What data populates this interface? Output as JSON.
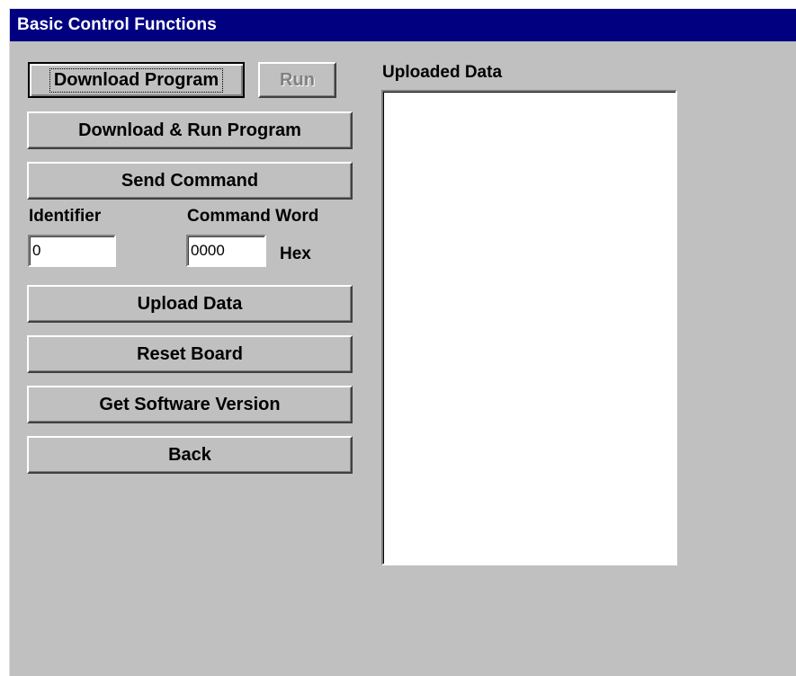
{
  "window": {
    "title": "Basic Control Functions"
  },
  "buttons": {
    "download_program": "Download Program",
    "run": "Run",
    "download_run_program": "Download & Run Program",
    "send_command": "Send Command",
    "upload_data": "Upload Data",
    "reset_board": "Reset Board",
    "get_software_version": "Get Software Version",
    "back": "Back"
  },
  "command": {
    "identifier_label": "Identifier",
    "identifier_value": "0",
    "command_word_label": "Command Word",
    "command_word_value": "0000",
    "hex_label": "Hex"
  },
  "uploaded": {
    "label": "Uploaded Data"
  }
}
